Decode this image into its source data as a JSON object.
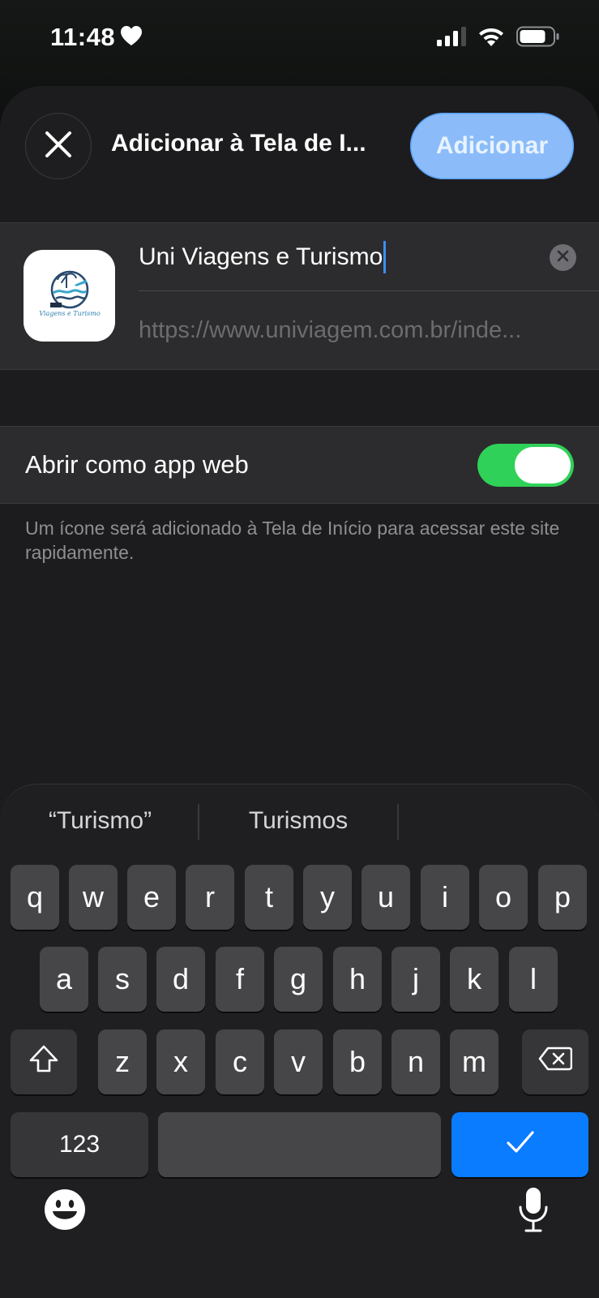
{
  "status_bar": {
    "time": "11:48"
  },
  "sheet": {
    "title": "Adicionar à Tela de I...",
    "add_button": "Adicionar"
  },
  "card": {
    "name_value": "Uni Viagens e Turismo",
    "url_value": "https://www.univiagem.com.br/inde...",
    "icon_caption": "Viagens e Turismo"
  },
  "settings": {
    "web_app_label": "Abrir como app web",
    "web_app_enabled": true,
    "footnote": "Um ícone será adicionado à Tela de Início para acessar este site rapidamente."
  },
  "keyboard": {
    "suggestions": [
      "“Turismo”",
      "Turismos",
      ""
    ],
    "rows": [
      [
        "q",
        "w",
        "e",
        "r",
        "t",
        "y",
        "u",
        "i",
        "o",
        "p"
      ],
      [
        "a",
        "s",
        "d",
        "f",
        "g",
        "h",
        "j",
        "k",
        "l"
      ],
      [
        "z",
        "x",
        "c",
        "v",
        "b",
        "n",
        "m"
      ]
    ],
    "numbers_key": "123",
    "icons": {
      "shift": "shift-icon",
      "backspace": "backspace-icon",
      "done": "checkmark-icon",
      "emoji": "emoji-icon",
      "dictation": "microphone-icon"
    }
  },
  "colors": {
    "accent_blue": "#0a7cff",
    "add_button_bg": "#8bbcf9",
    "toggle_on": "#30d158",
    "sheet_bg": "#1c1c1e",
    "cell_bg": "#2c2c2e"
  }
}
